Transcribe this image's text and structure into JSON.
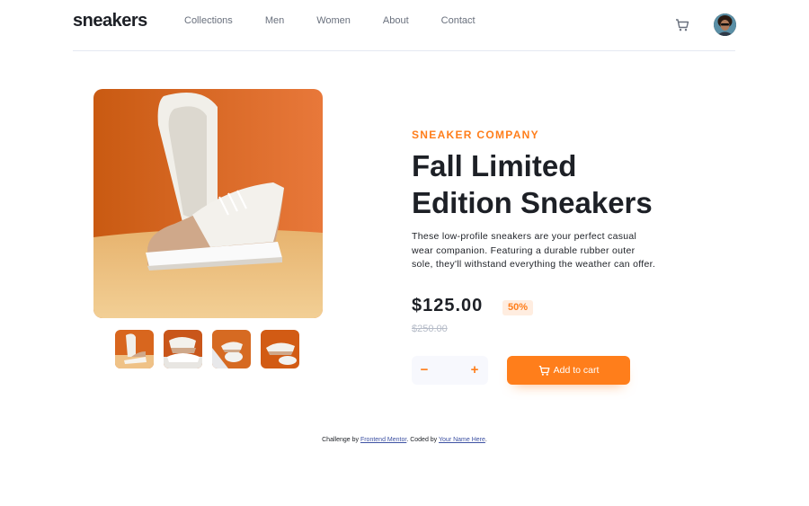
{
  "header": {
    "logo": "sneakers",
    "nav": [
      "Collections",
      "Men",
      "Women",
      "About",
      "Contact"
    ]
  },
  "icons": {
    "cart": "cart-icon",
    "avatar": "avatar"
  },
  "product": {
    "company": "SNEAKER COMPANY",
    "title_line1": "Fall Limited",
    "title_line2": "Edition Sneakers",
    "description": "These low-profile sneakers are your perfect casual wear companion. Featuring a durable rubber outer sole, they'll withstand everything the weather can offer.",
    "price": "$125.00",
    "discount": "50%",
    "old_price": "$250.00"
  },
  "cart_controls": {
    "minus": "−",
    "quantity": "",
    "plus": "+",
    "add_label": "Add to cart"
  },
  "footer": {
    "prefix": "Challenge by",
    "link1": "Frontend Mentor",
    "middle": ". Coded by",
    "link2": "Your Name Here",
    "suffix": "."
  },
  "colors": {
    "accent": "#ff7e1b",
    "accent_light": "#ffede0",
    "dark": "#1d2026",
    "grey": "#69707d"
  }
}
